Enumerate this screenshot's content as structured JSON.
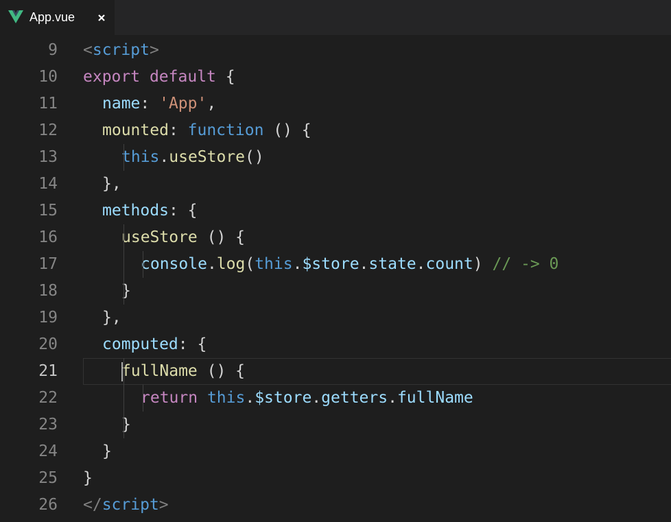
{
  "tab": {
    "filename": "App.vue",
    "file_icon": "vue-icon",
    "close_icon": "close-icon"
  },
  "editor": {
    "active_line": 21,
    "lines": [
      {
        "num": "9",
        "indent": 0,
        "tokens": [
          [
            "tag",
            "<"
          ],
          [
            "tagn",
            "script"
          ],
          [
            "tag",
            ">"
          ]
        ]
      },
      {
        "num": "10",
        "indent": 0,
        "tokens": [
          [
            "kw",
            "export"
          ],
          [
            "txt",
            " "
          ],
          [
            "kw",
            "default"
          ],
          [
            "txt",
            " {"
          ]
        ]
      },
      {
        "num": "11",
        "indent": 1,
        "tokens": [
          [
            "prop",
            "name"
          ],
          [
            "txt",
            ": "
          ],
          [
            "str",
            "'App'"
          ],
          [
            "txt",
            ","
          ]
        ]
      },
      {
        "num": "12",
        "indent": 1,
        "tokens": [
          [
            "fn",
            "mounted"
          ],
          [
            "txt",
            ": "
          ],
          [
            "st",
            "function"
          ],
          [
            "txt",
            " () {"
          ]
        ]
      },
      {
        "num": "13",
        "indent": 2,
        "tokens": [
          [
            "st",
            "this"
          ],
          [
            "txt",
            "."
          ],
          [
            "fn",
            "useStore"
          ],
          [
            "txt",
            "()"
          ]
        ]
      },
      {
        "num": "14",
        "indent": 1,
        "tokens": [
          [
            "txt",
            "},"
          ]
        ]
      },
      {
        "num": "15",
        "indent": 1,
        "tokens": [
          [
            "prop",
            "methods"
          ],
          [
            "txt",
            ": {"
          ]
        ]
      },
      {
        "num": "16",
        "indent": 2,
        "tokens": [
          [
            "fn",
            "useStore"
          ],
          [
            "txt",
            " () {"
          ]
        ]
      },
      {
        "num": "17",
        "indent": 3,
        "tokens": [
          [
            "var",
            "console"
          ],
          [
            "txt",
            "."
          ],
          [
            "fn",
            "log"
          ],
          [
            "txt",
            "("
          ],
          [
            "st",
            "this"
          ],
          [
            "txt",
            "."
          ],
          [
            "var",
            "$store"
          ],
          [
            "txt",
            "."
          ],
          [
            "var",
            "state"
          ],
          [
            "txt",
            "."
          ],
          [
            "var",
            "count"
          ],
          [
            "txt",
            ") "
          ],
          [
            "cm",
            "// -> 0"
          ]
        ]
      },
      {
        "num": "18",
        "indent": 2,
        "tokens": [
          [
            "txt",
            "}"
          ]
        ]
      },
      {
        "num": "19",
        "indent": 1,
        "tokens": [
          [
            "txt",
            "},"
          ]
        ]
      },
      {
        "num": "20",
        "indent": 1,
        "tokens": [
          [
            "prop",
            "computed"
          ],
          [
            "txt",
            ": {"
          ]
        ]
      },
      {
        "num": "21",
        "indent": 2,
        "tokens": [
          [
            "fn",
            "fullName"
          ],
          [
            "txt",
            " () {"
          ]
        ]
      },
      {
        "num": "22",
        "indent": 3,
        "tokens": [
          [
            "kw",
            "return"
          ],
          [
            "txt",
            " "
          ],
          [
            "st",
            "this"
          ],
          [
            "txt",
            "."
          ],
          [
            "var",
            "$store"
          ],
          [
            "txt",
            "."
          ],
          [
            "var",
            "getters"
          ],
          [
            "txt",
            "."
          ],
          [
            "var",
            "fullName"
          ]
        ]
      },
      {
        "num": "23",
        "indent": 2,
        "tokens": [
          [
            "txt",
            "}"
          ]
        ]
      },
      {
        "num": "24",
        "indent": 1,
        "tokens": [
          [
            "txt",
            "}"
          ]
        ]
      },
      {
        "num": "25",
        "indent": 0,
        "tokens": [
          [
            "txt",
            "}"
          ]
        ]
      },
      {
        "num": "26",
        "indent": 0,
        "tokens": [
          [
            "tag",
            "</"
          ],
          [
            "tagn",
            "script"
          ],
          [
            "tag",
            ">"
          ]
        ]
      }
    ]
  }
}
